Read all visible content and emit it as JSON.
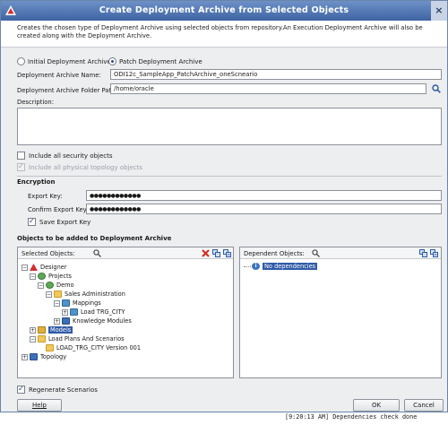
{
  "window": {
    "title": "Create Deployment Archive from Selected Objects"
  },
  "description": "Creates the chosen type of Deployment Archive using selected objects from repository.An Execution Deployment Archive will also be created along with the Deployment Archive.",
  "archive_type": {
    "initial_label": "Initial Deployment Archive",
    "patch_label": "Patch Deployment Archive",
    "selected": "patch"
  },
  "fields": {
    "name_label": "Deployment Archive Name:",
    "name_value": "ODI12c_SampleApp_PatchArchive_oneScneario",
    "folder_label": "Deployment Archive Folder Path:",
    "folder_value": "/home/oracle",
    "description_label": "Description:",
    "description_value": ""
  },
  "options": {
    "security_label": "Include all security objects",
    "security_checked": false,
    "topology_label": "Include all physical topology objects",
    "topology_checked": true
  },
  "encryption": {
    "section_label": "Encryption",
    "export_key_label": "Export Key:",
    "export_key_value": "●●●●●●●●●●●●",
    "confirm_key_label": "Confirm Export Key:",
    "confirm_key_value": "●●●●●●●●●●●●",
    "save_key_label": "Save Export Key",
    "save_key_checked": true
  },
  "objects": {
    "section_label": "Objects to be added to Deployment Archive",
    "selected_label": "Selected Objects:",
    "dependent_label": "Dependent Objects:",
    "tree": [
      {
        "label": "Designer",
        "icon": "designer-icon"
      },
      {
        "label": "Projects",
        "icon": "projects-icon"
      },
      {
        "label": "Demo",
        "icon": "project-icon"
      },
      {
        "label": "Sales Administration",
        "icon": "folder-icon"
      },
      {
        "label": "Mappings",
        "icon": "mappings-icon"
      },
      {
        "label": "Load TRG_CITY",
        "icon": "mapping-icon"
      },
      {
        "label": "Knowledge Modules",
        "icon": "knowledge-modules-icon"
      },
      {
        "label": "Models",
        "icon": "models-icon"
      },
      {
        "label": "Load Plans And Scenarios",
        "icon": "folder-icon"
      },
      {
        "label": "LOAD_TRG_CITY Version 001",
        "icon": "scenario-icon"
      },
      {
        "label": "Topology",
        "icon": "topology-icon"
      }
    ],
    "dependent_tree": [
      {
        "label": "No dependencies",
        "icon": "info-icon"
      }
    ]
  },
  "footer": {
    "regenerate_label": "Regenerate Scenarios",
    "regenerate_checked": true,
    "help_label": "Help",
    "ok_label": "OK",
    "cancel_label": "Cancel"
  },
  "console": {
    "line": "[9:20:13 AM] Dependencies check done"
  },
  "colors": {
    "title_bar": "#3e64a3",
    "selection": "#2f5aa6",
    "logo": "#d32f2f"
  }
}
